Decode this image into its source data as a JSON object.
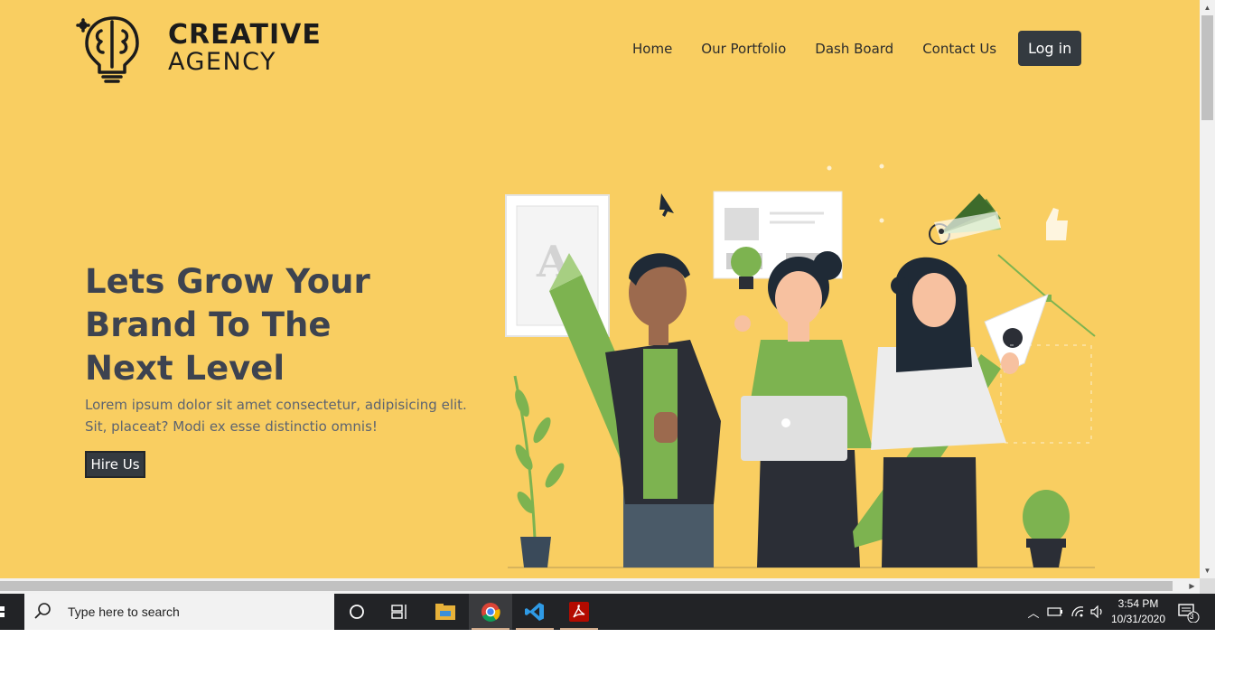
{
  "brand": {
    "line1": "CREATIVE",
    "line2": "AGENCY"
  },
  "nav": {
    "items": [
      {
        "label": "Home"
      },
      {
        "label": "Our Portfolio"
      },
      {
        "label": "Dash Board"
      },
      {
        "label": "Contact Us"
      }
    ],
    "login_label": "Log in"
  },
  "hero": {
    "title_lines": [
      "Lets Grow Your",
      "Brand To The",
      "Next Level"
    ],
    "description": "Lorem ipsum dolor sit amet consectetur, adipisicing elit. Sit, placeat? Modi ex esse distinctio omnis!",
    "cta_label": "Hire Us"
  },
  "colors": {
    "background": "#f9ce61",
    "dark": "#343a40",
    "green": "#78b24e",
    "text": "#3d4350"
  },
  "taskbar": {
    "search_placeholder": "Type here to search",
    "apps": [
      "cortana-icon",
      "task-view-icon",
      "file-explorer-icon",
      "chrome-icon",
      "vscode-icon",
      "acrobat-icon"
    ],
    "time": "3:54 PM",
    "date": "10/31/2020",
    "notification_count": "3"
  }
}
